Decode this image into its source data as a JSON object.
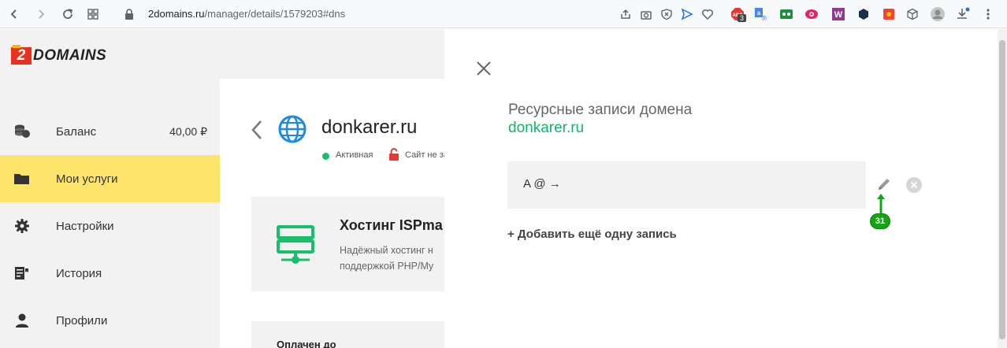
{
  "browser": {
    "url_domain": "2domains.ru",
    "url_path": "/manager/details/1579203#dns",
    "ext_badge_count": "3"
  },
  "logo": {
    "mark": "2",
    "text": "DOMAINS"
  },
  "sidebar": {
    "items": [
      {
        "label": "Баланс",
        "value": "40,00 ₽",
        "icon": "coins-icon"
      },
      {
        "label": "Мои услуги",
        "icon": "folder-icon",
        "active": true
      },
      {
        "label": "Настройки",
        "icon": "gear-icon"
      },
      {
        "label": "История",
        "icon": "history-icon"
      },
      {
        "label": "Профили",
        "icon": "user-icon"
      }
    ]
  },
  "domain_page": {
    "title": "donkarer.ru",
    "status": "Активная",
    "ssl_status": "Сайт не за",
    "card_title": "Хостинг ISPma",
    "card_desc_line1": "Надёжный хостинг н",
    "card_desc_line2": "поддержкой PHP/My",
    "paid_label": "Оплачен до"
  },
  "modal": {
    "title": "Ресурсные записи домена",
    "domain": "donkarer.ru",
    "record": "A @ →",
    "add_label": "+ Добавить ещё одну запись",
    "annotation_number": "31"
  },
  "colors": {
    "accent_green": "#19b368",
    "active_yellow": "#fde46a",
    "logo_red": "#e8321e",
    "globe_blue": "#1e88e5"
  }
}
